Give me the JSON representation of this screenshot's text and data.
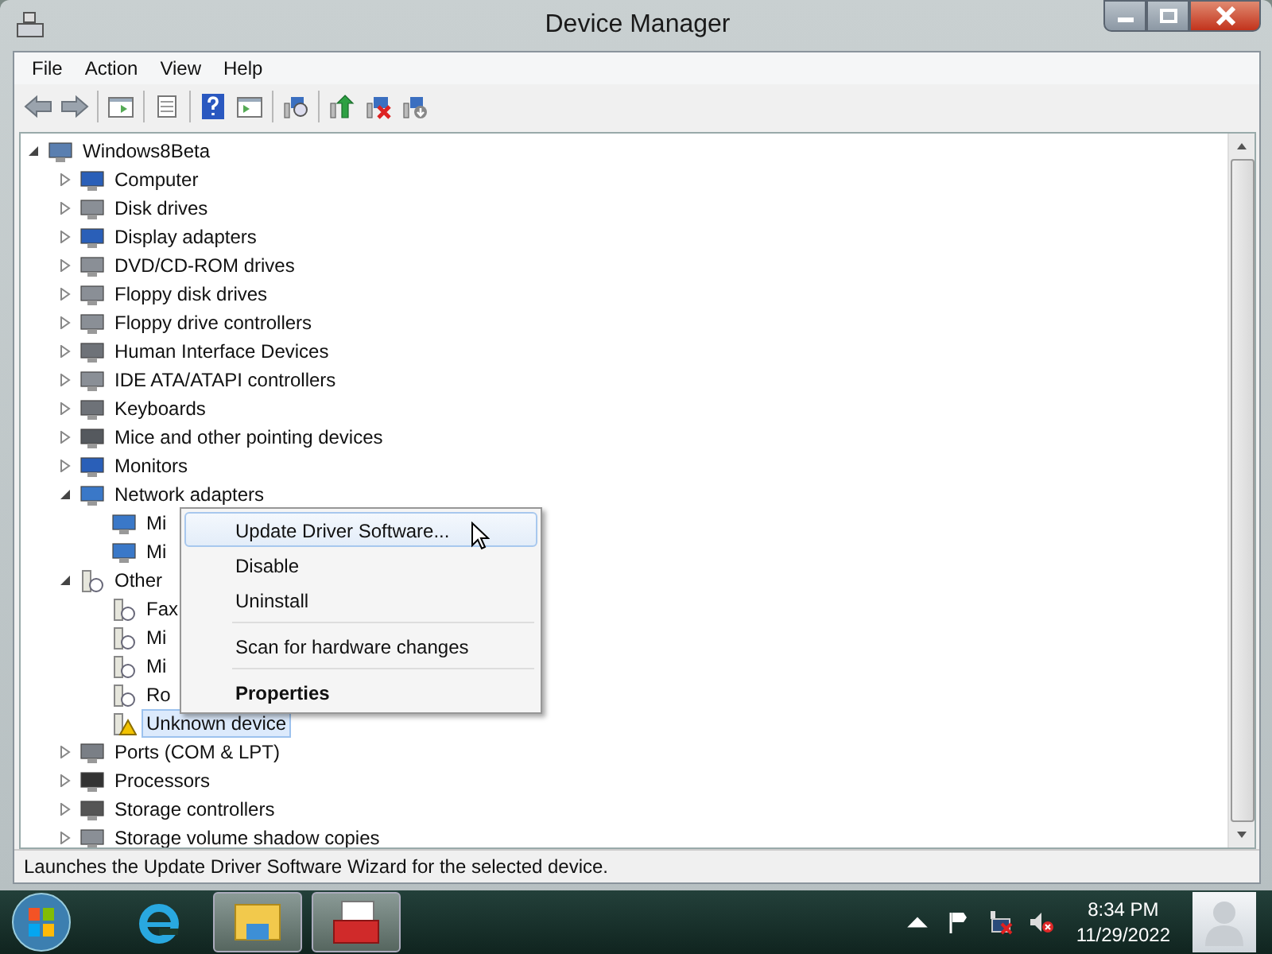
{
  "window": {
    "title": "Device Manager"
  },
  "menu": [
    {
      "label": "File"
    },
    {
      "label": "Action"
    },
    {
      "label": "View"
    },
    {
      "label": "Help"
    }
  ],
  "toolbar": [
    {
      "kind": "back"
    },
    {
      "kind": "forward"
    },
    {
      "kind": "sep"
    },
    {
      "kind": "tree"
    },
    {
      "kind": "sep"
    },
    {
      "kind": "props"
    },
    {
      "kind": "sep"
    },
    {
      "kind": "help"
    },
    {
      "kind": "pane"
    },
    {
      "kind": "sep"
    },
    {
      "kind": "scan"
    },
    {
      "kind": "sep"
    },
    {
      "kind": "update"
    },
    {
      "kind": "disable"
    },
    {
      "kind": "uninstall"
    }
  ],
  "tree": [
    {
      "label": "Windows8Beta",
      "expanded": true,
      "selected": false,
      "children": [
        {
          "label": "Computer",
          "expanded": false,
          "selected": false
        },
        {
          "label": "Disk drives",
          "expanded": false,
          "selected": false
        },
        {
          "label": "Display adapters",
          "expanded": false,
          "selected": false
        },
        {
          "label": "DVD/CD-ROM drives",
          "expanded": false,
          "selected": false
        },
        {
          "label": "Floppy disk drives",
          "expanded": false,
          "selected": false
        },
        {
          "label": "Floppy drive controllers",
          "expanded": false,
          "selected": false
        },
        {
          "label": "Human Interface Devices",
          "expanded": false,
          "selected": false
        },
        {
          "label": "IDE ATA/ATAPI controllers",
          "expanded": false,
          "selected": false
        },
        {
          "label": "Keyboards",
          "expanded": false,
          "selected": false
        },
        {
          "label": "Mice and other pointing devices",
          "expanded": false,
          "selected": false
        },
        {
          "label": "Monitors",
          "expanded": false,
          "selected": false
        },
        {
          "label": "Network adapters",
          "expanded": true,
          "selected": false,
          "children": [
            {
              "label": "Mi",
              "selected": false,
              "problem": false
            },
            {
              "label": "Mi",
              "selected": false,
              "problem": false
            }
          ]
        },
        {
          "label": "Other",
          "expanded": true,
          "selected": false,
          "children": [
            {
              "label": "Fax",
              "selected": false,
              "problem": false
            },
            {
              "label": "Mi",
              "selected": false,
              "problem": false
            },
            {
              "label": "Mi",
              "selected": false,
              "problem": false
            },
            {
              "label": "Ro",
              "selected": false,
              "problem": false
            },
            {
              "label": "Unknown device",
              "selected": true,
              "problem": true
            }
          ]
        },
        {
          "label": "Ports (COM & LPT)",
          "expanded": false,
          "selected": false
        },
        {
          "label": "Processors",
          "expanded": false,
          "selected": false
        },
        {
          "label": "Storage controllers",
          "expanded": false,
          "selected": false
        },
        {
          "label": "Storage volume shadow copies",
          "expanded": false,
          "selected": false
        }
      ]
    }
  ],
  "context_menu": [
    {
      "kind": "item",
      "label": "Update Driver Software...",
      "selected": true
    },
    {
      "kind": "item",
      "label": "Disable",
      "selected": false
    },
    {
      "kind": "item",
      "label": "Uninstall",
      "selected": false
    },
    {
      "kind": "sep"
    },
    {
      "kind": "item",
      "label": "Scan for hardware changes",
      "selected": false
    },
    {
      "kind": "sep"
    },
    {
      "kind": "default",
      "label": "Properties",
      "selected": false
    }
  ],
  "status_bar": "Launches the Update Driver Software Wizard for the selected device.",
  "taskbar": {
    "apps": [
      {
        "kind": "ie",
        "selected": false
      },
      {
        "kind": "explorer",
        "selected": true
      },
      {
        "kind": "toolbox",
        "selected": true
      }
    ],
    "time": "8:34 PM",
    "date": "11/29/2022"
  }
}
